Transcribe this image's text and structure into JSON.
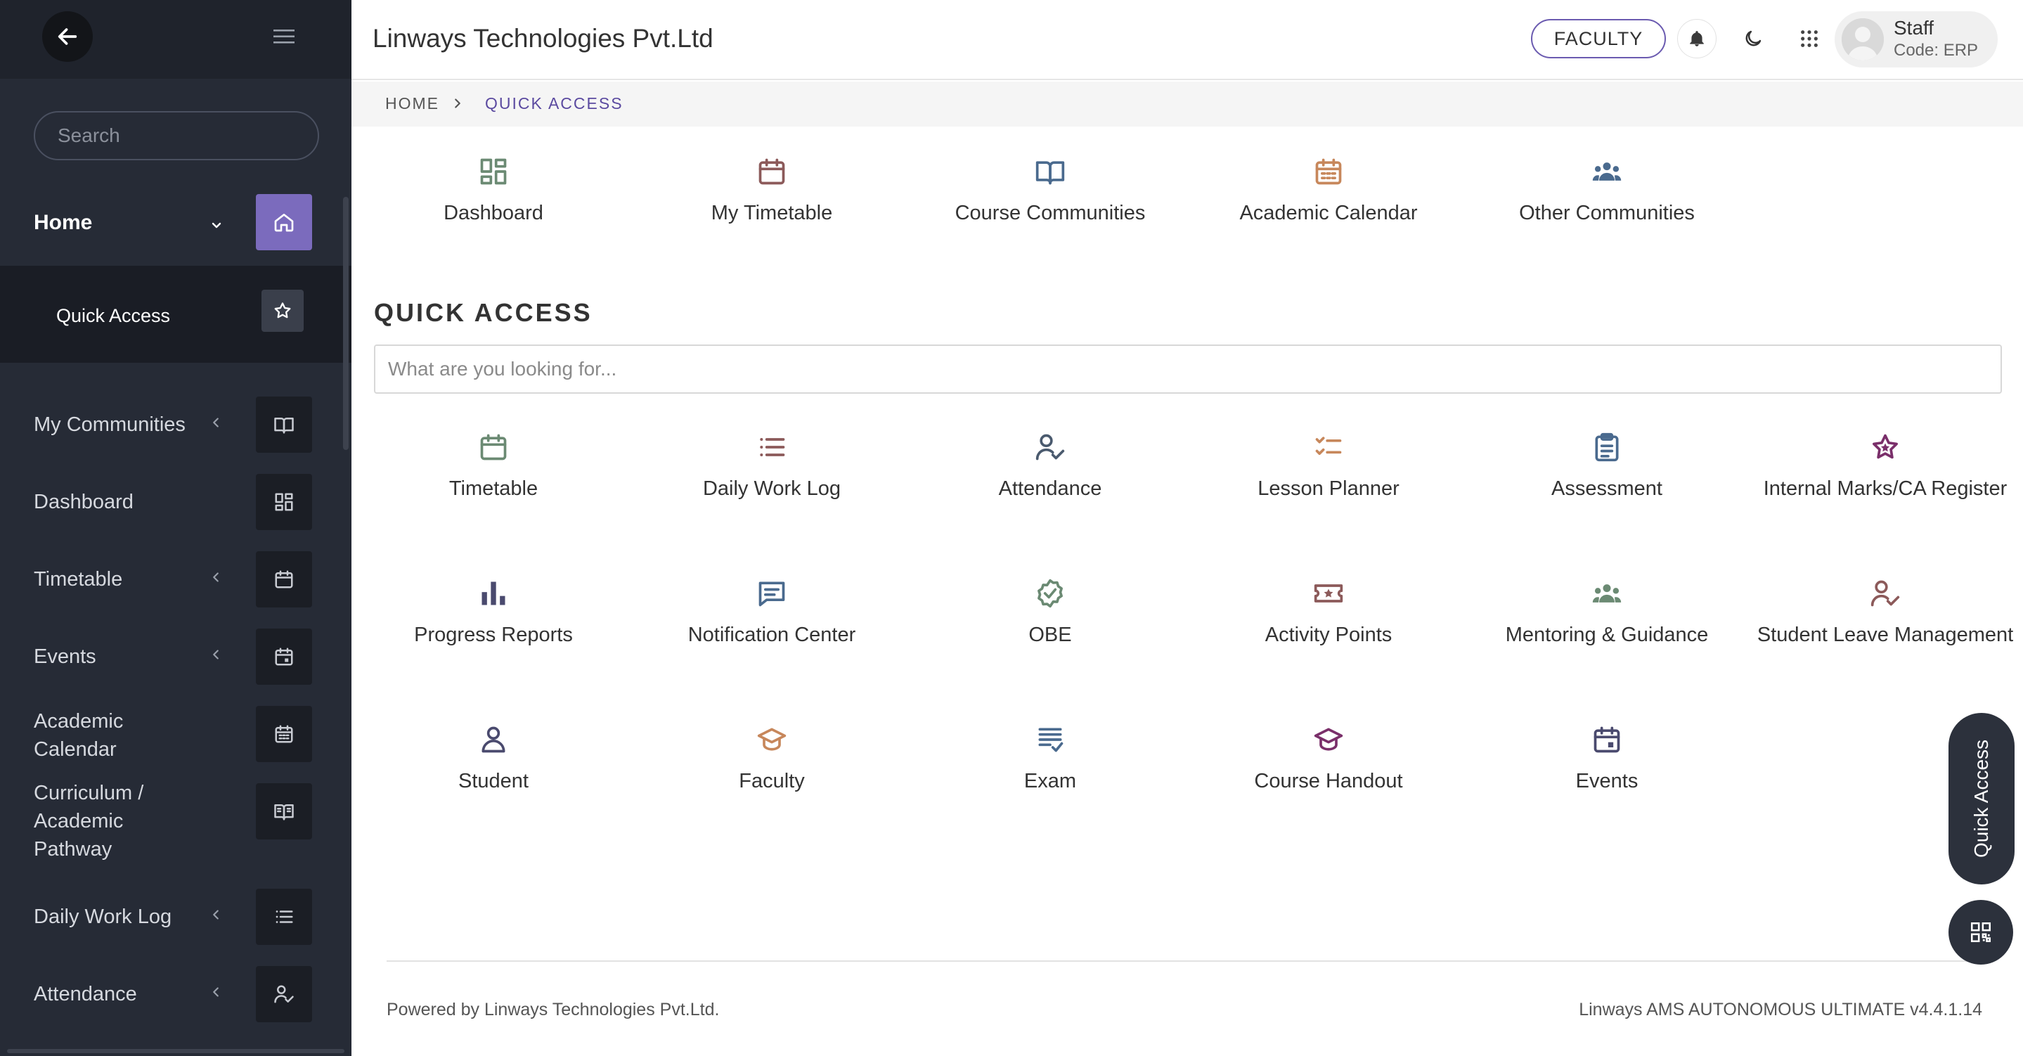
{
  "sidebar": {
    "search_placeholder": "Search",
    "home_label": "Home",
    "quick_access_label": "Quick Access",
    "items": [
      {
        "label": "My Communities",
        "icon": "book-open-icon",
        "has_chevron": true
      },
      {
        "label": "Dashboard",
        "icon": "dashboard-icon",
        "has_chevron": false
      },
      {
        "label": "Timetable",
        "icon": "calendar-icon",
        "has_chevron": true
      },
      {
        "label": "Events",
        "icon": "calendar-event-icon",
        "has_chevron": true
      },
      {
        "label": "Academic Calendar",
        "icon": "calendar-grid-icon",
        "has_chevron": false
      },
      {
        "label": "Curriculum / Academic Pathway",
        "icon": "book-icon",
        "has_chevron": false
      },
      {
        "label": "Daily Work Log",
        "icon": "list-icon",
        "has_chevron": true
      },
      {
        "label": "Attendance",
        "icon": "user-check-icon",
        "has_chevron": true
      }
    ]
  },
  "header": {
    "org_name": "Linways Technologies Pvt.Ltd",
    "role_button": "FACULTY",
    "user_name": "Staff",
    "user_code": "Code: ERP"
  },
  "breadcrumb": {
    "home": "HOME",
    "current": "QUICK ACCESS"
  },
  "top_shortcuts": [
    {
      "label": "Dashboard",
      "icon": "dashboard-icon",
      "color": "#6b8a73"
    },
    {
      "label": "My Timetable",
      "icon": "calendar-icon",
      "color": "#8c5a5a"
    },
    {
      "label": "Course Communities",
      "icon": "book-open-icon",
      "color": "#4a6a8e"
    },
    {
      "label": "Academic Calendar",
      "icon": "calendar-grid-icon",
      "color": "#c7875b"
    },
    {
      "label": "Other Communities",
      "icon": "group-icon",
      "color": "#4a6a8e"
    }
  ],
  "quick_access": {
    "title": "QUICK ACCESS",
    "search_placeholder": "What are you looking for...",
    "tiles": [
      {
        "label": "Timetable",
        "icon": "calendar-icon",
        "color": "#6b8a73"
      },
      {
        "label": "Daily Work Log",
        "icon": "list-icon",
        "color": "#8c5a5a"
      },
      {
        "label": "Attendance",
        "icon": "user-check-icon",
        "color": "#4a5a6e"
      },
      {
        "label": "Lesson Planner",
        "icon": "checklist-icon",
        "color": "#c7875b"
      },
      {
        "label": "Assessment",
        "icon": "clipboard-icon",
        "color": "#4a6a8e"
      },
      {
        "label": "Internal Marks/CA Register",
        "icon": "star-icon",
        "color": "#7a2f6a"
      },
      {
        "label": "Progress Reports",
        "icon": "bar-chart-icon",
        "color": "#4a4a6e"
      },
      {
        "label": "Notification Center",
        "icon": "message-icon",
        "color": "#4a6a8e"
      },
      {
        "label": "OBE",
        "icon": "badge-check-icon",
        "color": "#6b8a73"
      },
      {
        "label": "Activity Points",
        "icon": "ticket-star-icon",
        "color": "#8c5a5a"
      },
      {
        "label": "Mentoring & Guidance",
        "icon": "group-icon",
        "color": "#6b8a73"
      },
      {
        "label": "Student Leave Management",
        "icon": "user-check-icon",
        "color": "#8c5a5a"
      },
      {
        "label": "Student",
        "icon": "user-icon",
        "color": "#4a4a6e"
      },
      {
        "label": "Faculty",
        "icon": "graduation-cap-icon",
        "color": "#c7875b"
      },
      {
        "label": "Exam",
        "icon": "doc-check-icon",
        "color": "#4a6a8e"
      },
      {
        "label": "Course Handout",
        "icon": "graduation-cap-icon",
        "color": "#7a2f6a"
      },
      {
        "label": "Events",
        "icon": "calendar-event-icon",
        "color": "#4a4a6e"
      }
    ]
  },
  "footer": {
    "left": "Powered by Linways Technologies Pvt.Ltd.",
    "right": "Linways AMS AUTONOMOUS ULTIMATE v4.4.1.14"
  },
  "floating": {
    "quick_access_label": "Quick Access"
  }
}
